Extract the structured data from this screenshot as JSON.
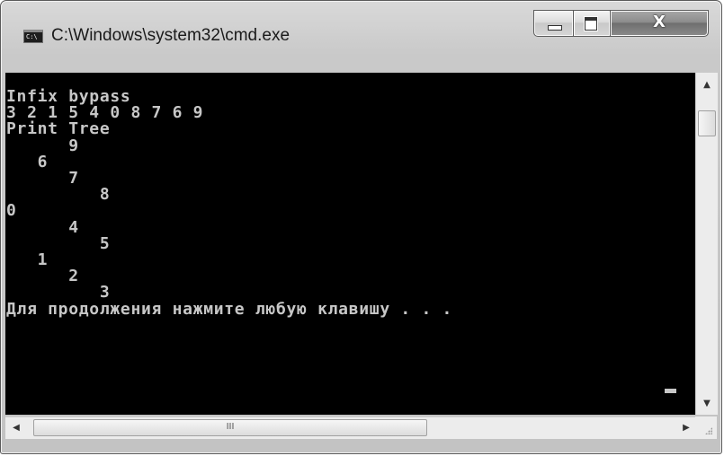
{
  "window": {
    "title": "C:\\Windows\\system32\\cmd.exe",
    "app_icon_text": "C:\\",
    "controls": {
      "minimize": "minimize-icon",
      "maximize": "maximize-icon",
      "close": "close-icon",
      "close_glyph": "X"
    }
  },
  "console": {
    "background": "#000000",
    "foreground": "#c7c7c7",
    "lines": [
      "Infix bypass",
      "3 2 1 5 4 0 8 7 6 9",
      "Print Tree",
      "      9",
      "   6",
      "      7",
      "         8",
      "0",
      "      4",
      "         5",
      "   1",
      "      2",
      "         3",
      "Для продолжения нажмите любую клавишу . . . "
    ]
  },
  "scrollbars": {
    "vertical": {
      "up_icon": "scroll-up-arrow-icon",
      "down_icon": "scroll-down-arrow-icon",
      "up_glyph": "▲",
      "down_glyph": "▼"
    },
    "horizontal": {
      "left_icon": "scroll-left-arrow-icon",
      "right_icon": "scroll-right-arrow-icon",
      "left_glyph": "◀",
      "right_glyph": "▶",
      "thumb_grip": "III"
    }
  }
}
